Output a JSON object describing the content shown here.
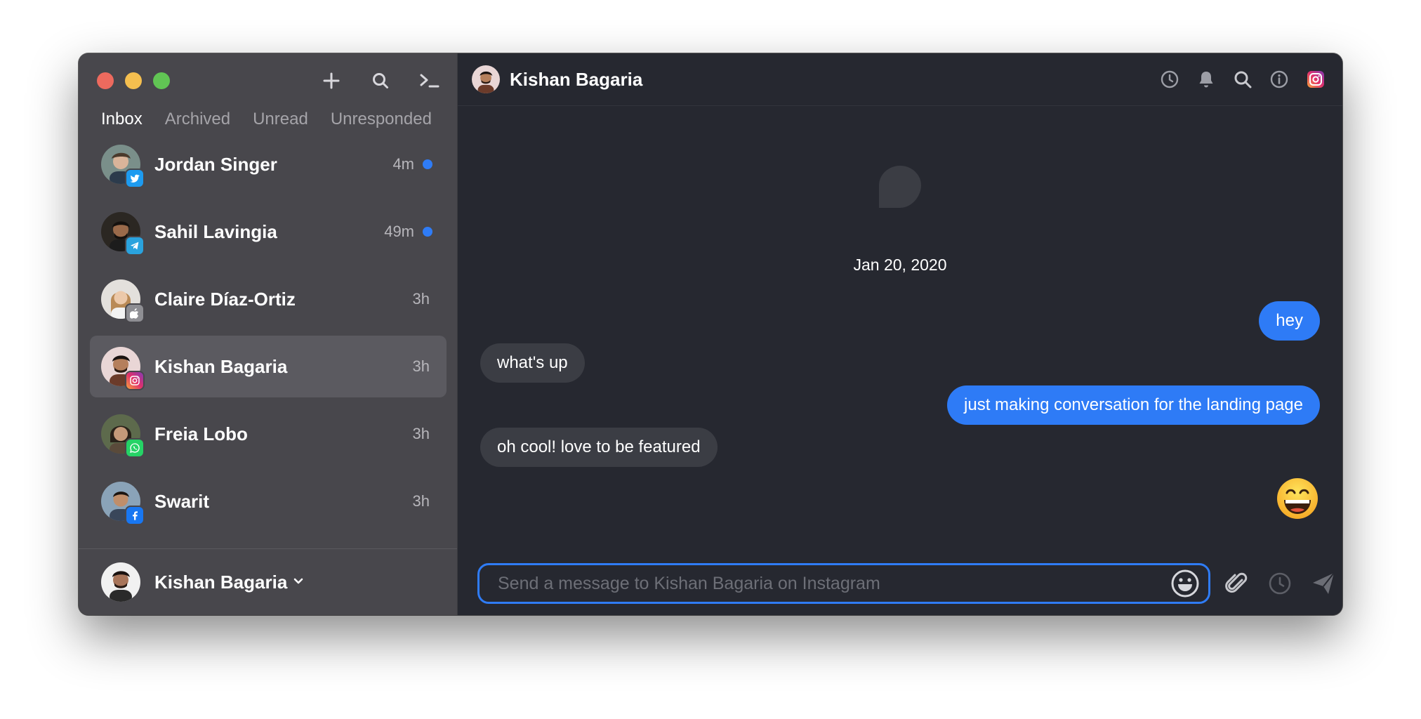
{
  "sidebar": {
    "tabs": [
      {
        "label": "Inbox",
        "active": true
      },
      {
        "label": "Archived",
        "active": false
      },
      {
        "label": "Unread",
        "active": false
      },
      {
        "label": "Unresponded",
        "active": false
      }
    ],
    "threads": [
      {
        "name": "Jordan Singer",
        "time": "4m",
        "unread": true,
        "network": "twitter"
      },
      {
        "name": "Sahil Lavingia",
        "time": "49m",
        "unread": true,
        "network": "telegram"
      },
      {
        "name": "Claire Díaz-Ortiz",
        "time": "3h",
        "unread": false,
        "network": "imessage"
      },
      {
        "name": "Kishan Bagaria",
        "time": "3h",
        "unread": false,
        "network": "instagram",
        "selected": true
      },
      {
        "name": "Freia Lobo",
        "time": "3h",
        "unread": false,
        "network": "whatsapp"
      },
      {
        "name": "Swarit",
        "time": "3h",
        "unread": false,
        "network": "facebook"
      }
    ],
    "account": {
      "name": "Kishan Bagaria"
    }
  },
  "conversation": {
    "title": "Kishan Bagaria",
    "date_separator": "Jan 20, 2020",
    "messages": [
      {
        "direction": "out",
        "text": "hey"
      },
      {
        "direction": "in",
        "text": "what's up"
      },
      {
        "direction": "out",
        "text": "just making conversation for the landing page"
      },
      {
        "direction": "in",
        "text": "oh cool! love to be featured"
      },
      {
        "direction": "out",
        "emoji": "grinning-face"
      }
    ],
    "composer_placeholder": "Send a message to Kishan Bagaria on Instagram"
  },
  "colors": {
    "accent": "#2f7cf6",
    "sidebar_bg": "#48474c",
    "main_bg": "#262830",
    "incoming_bubble": "#3b3d44",
    "outgoing_bubble": "#2e7bf6"
  }
}
